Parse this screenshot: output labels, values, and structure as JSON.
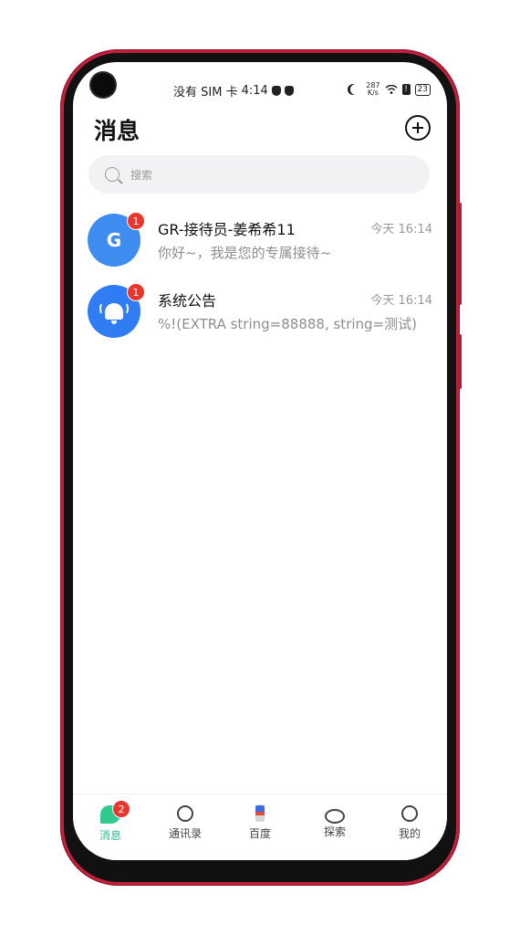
{
  "status_bar": {
    "carrier": "没有 SIM 卡",
    "time": "4:14",
    "speed_value": "287",
    "speed_unit": "K/s",
    "battery": "23"
  },
  "header": {
    "title": "消息",
    "add_icon": "plus-circle-icon"
  },
  "search": {
    "placeholder": "搜索",
    "icon": "search-icon"
  },
  "conversations": [
    {
      "name": "GR-接待员-姜希希11",
      "time": "今天 16:14",
      "preview": "你好~，我是您的专属接待~",
      "avatar_letter": "G",
      "unread": "1",
      "avatar_color": "#3e8cf0"
    },
    {
      "name": "系统公告",
      "time": "今天 16:14",
      "preview": "%!(EXTRA string=88888, string=测试)",
      "avatar_icon": "bell-icon",
      "unread": "1",
      "avatar_color": "#2f7cf5"
    }
  ],
  "bottom_nav": {
    "items": [
      {
        "label": "消息",
        "icon": "message-icon",
        "badge": "2",
        "active": true
      },
      {
        "label": "通讯录",
        "icon": "contacts-icon"
      },
      {
        "label": "百度",
        "icon": "baidu-icon"
      },
      {
        "label": "探索",
        "icon": "planet-icon"
      },
      {
        "label": "我的",
        "icon": "profile-icon"
      }
    ]
  },
  "colors": {
    "accent": "#2bc08a",
    "badge": "#e8372c",
    "phone_frame": "#c2213e"
  }
}
